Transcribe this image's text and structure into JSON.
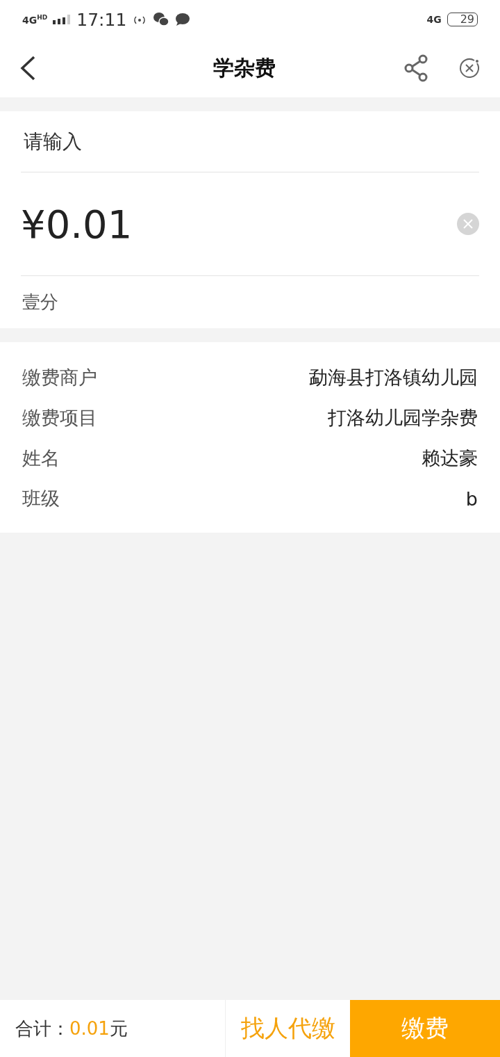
{
  "status_bar": {
    "network": "4G",
    "network_badge": "HD",
    "time": "17:11",
    "right_network": "4G",
    "battery": "29"
  },
  "nav": {
    "title": "学杂费"
  },
  "amount_card": {
    "prompt": "请输入",
    "amount": "¥0.01",
    "amount_words": "壹分"
  },
  "details": [
    {
      "label": "缴费商户",
      "value": "勐海县打洛镇幼儿园"
    },
    {
      "label": "缴费项目",
      "value": "打洛幼儿园学杂费"
    },
    {
      "label": "姓名",
      "value": "赖达豪"
    },
    {
      "label": "班级",
      "value": "b"
    }
  ],
  "footer": {
    "total_label": "合计：",
    "total_amount": "0.01",
    "total_unit": "元",
    "proxy_button": "找人代缴",
    "pay_button": "缴费"
  }
}
